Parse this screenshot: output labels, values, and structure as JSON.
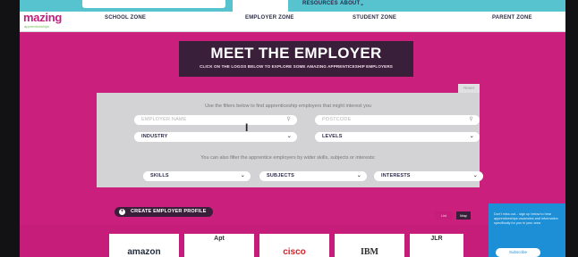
{
  "site": {
    "logo_text": "mazing",
    "logo_subtext": "apprenticeships"
  },
  "utility_nav": {
    "resources": "RESOURCES",
    "about": "ABOUT",
    "about_chevron": "chevron-down-icon"
  },
  "main_nav": {
    "items": [
      "SCHOOL ZONE",
      "EMPLOYER ZONE",
      "STUDENT ZONE",
      "PARENT ZONE"
    ]
  },
  "hero": {
    "title": "MEET THE EMPLOYER",
    "subtitle": "CLICK ON THE LOGOS BELOW TO EXPLORE SOME AMAZING APPRENTICESHIP EMPLOYERS"
  },
  "filters": {
    "reset_label": "Reset",
    "hint_primary": "Use the filters below to find apprenticeship employers that might interest you",
    "hint_secondary": "You can also filter the apprentice employers by wider skills, subjects or interests:",
    "employer_name_placeholder": "EMPLOYER NAME",
    "postcode_placeholder": "POSTCODE",
    "industry": "INDUSTRY",
    "levels": "LEVELS",
    "skills": "SKILLS",
    "subjects": "SUBJECTS",
    "interests": "INTERESTS"
  },
  "actions": {
    "create_profile": "CREATE EMPLOYER PROFILE",
    "view_toggle": [
      "List",
      "Map"
    ]
  },
  "employers": {
    "cards": [
      "amazon",
      "Apt",
      "cisco",
      "IBM",
      "JLR"
    ]
  },
  "chat_widget": {
    "text": "Don't miss out... sign up below to hear apprenticeships vacancies and information specifically for you in your area",
    "button": "Subscribe"
  },
  "colors": {
    "brand_magenta": "#cb1f7e",
    "brand_dark": "#3a1f3b",
    "header_cyan": "#56c3cf",
    "chat_blue": "#1d8fd6"
  }
}
